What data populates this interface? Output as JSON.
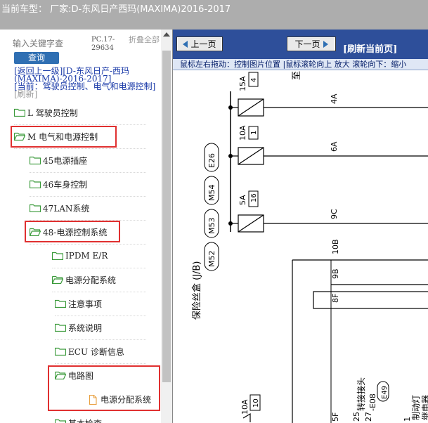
{
  "window": {
    "title": "当前车型：  厂家:D-东风日产西玛(MAXIMA)2016-2017"
  },
  "left_panel": {
    "search_placeholder": "输入关键字查",
    "query_button": "查询",
    "version": "PC.17-29634",
    "collapse_all": "折叠全部",
    "path": {
      "back_link": "[返回上一级]",
      "model": "[D-东风日产-西玛(MAXIMA)-2016-2017]",
      "current": "[当前：驾驶员控制、电气和电源控制]",
      "refresh": "[刷新]"
    },
    "tree": [
      {
        "label": "L 驾驶员控制",
        "type": "folder"
      },
      {
        "label": "M 电气和电源控制",
        "type": "folder-open",
        "highlighted": true
      },
      {
        "label": "45电源插座",
        "type": "folder"
      },
      {
        "label": "46车身控制",
        "type": "folder"
      },
      {
        "label": "47LAN系统",
        "type": "folder"
      },
      {
        "label": "48-电源控制系统",
        "type": "folder-open",
        "highlighted": true
      },
      {
        "label": "IPDM E/R",
        "type": "folder"
      },
      {
        "label": "电源分配系统",
        "type": "folder-open"
      },
      {
        "label": "注意事项",
        "type": "folder"
      },
      {
        "label": "系统说明",
        "type": "folder"
      },
      {
        "label": "ECU 诊断信息",
        "type": "folder"
      },
      {
        "label": "电路图",
        "type": "folder-open",
        "highlighted": true
      },
      {
        "label": "电源分配系统",
        "type": "document",
        "highlighted": true
      },
      {
        "label": "基本检查",
        "type": "folder"
      }
    ]
  },
  "viewer": {
    "prev_page": "上一页",
    "next_page": "下一页",
    "refresh_page": "[刷新当前页]",
    "hint": "鼠标左右拖动：控制图片位置 |鼠标滚轮向上 放大  滚轮向下：缩小",
    "diagram_labels": {
      "top_char": "至",
      "fuse_block": "保险丝盒 (J/B)",
      "connectors": [
        "M52",
        "M53",
        "M54",
        "E26"
      ],
      "fuses": [
        {
          "amp": "15A",
          "num": "4",
          "pin": "4A"
        },
        {
          "amp": "10A",
          "num": "1",
          "pin": "6A"
        },
        {
          "amp": "5A",
          "num": "16",
          "pin": "9C"
        }
      ],
      "pins_extra": [
        "10B",
        "9B",
        "8F",
        "5F"
      ],
      "bottom_fuse": {
        "amp": "10A",
        "num": "10"
      },
      "joint": "转接接头",
      "joint_code": "-E08",
      "joint_num": "25",
      "joint_conn": "E49",
      "joint_num2": "27",
      "brake": "制动灯",
      "brake2": "继电器",
      "brake_num": "1"
    }
  },
  "colors": {
    "titlebar": "#adadad",
    "toolbar": "#2e4f9a",
    "highlight_border": "#e03030",
    "folder_green": "#3a9a3a",
    "link_blue": "#1a3aa8"
  }
}
